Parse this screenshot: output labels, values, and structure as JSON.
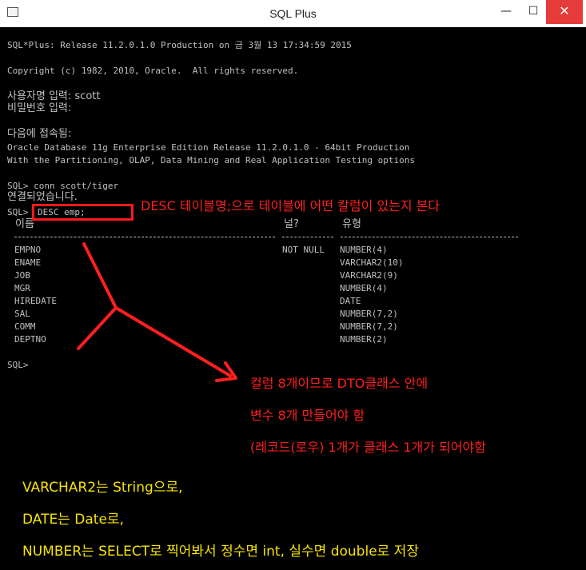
{
  "window": {
    "title": "SQL Plus",
    "minimize_glyph": "—",
    "maximize_glyph": "☐",
    "close_glyph": "✕"
  },
  "console": {
    "release_line": "SQL*Plus: Release 11.2.0.1.0 Production on 금 3월 13 17:34:59 2015",
    "copyright_line": "Copyright (c) 1982, 2010, Oracle.  All rights reserved.",
    "username_prompt": "사용자명 입력: scott",
    "password_prompt": "비밀번호 입력:",
    "connected_to": "다음에 접속됨:",
    "db_version": "Oracle Database 11g Enterprise Edition Release 11.2.0.1.0 - 64bit Production",
    "db_options": "With the Partitioning, OLAP, Data Mining and Real Application Testing options",
    "conn_command": "SQL> conn scott/tiger",
    "connected": "연결되었습니다.",
    "desc_prompt": "SQL>",
    "desc_command": "DESC emp;",
    "final_prompt": "SQL>"
  },
  "desc_table": {
    "headers": {
      "name": "이름",
      "null": "널?",
      "type": "유형"
    },
    "rows": [
      {
        "name": "EMPNO",
        "null": "NOT NULL",
        "type": "NUMBER(4)"
      },
      {
        "name": "ENAME",
        "null": "",
        "type": "VARCHAR2(10)"
      },
      {
        "name": "JOB",
        "null": "",
        "type": "VARCHAR2(9)"
      },
      {
        "name": "MGR",
        "null": "",
        "type": "NUMBER(4)"
      },
      {
        "name": "HIREDATE",
        "null": "",
        "type": "DATE"
      },
      {
        "name": "SAL",
        "null": "",
        "type": "NUMBER(7,2)"
      },
      {
        "name": "COMM",
        "null": "",
        "type": "NUMBER(7,2)"
      },
      {
        "name": "DEPTNO",
        "null": "",
        "type": "NUMBER(2)"
      }
    ]
  },
  "annotations": {
    "color_red": "#ff1f1f",
    "color_yellow": "#f7e400",
    "desc_note": "DESC 테이블명;으로 테이블에 어떤 칼럼이 있는지 본다",
    "dto_note_1": "컬럼 8개이므로 DTO클래스 안에",
    "dto_note_2": "변수 8개 만들어야 함",
    "dto_note_3": "(레코드(로우) 1개가 클래스 1개가 되어야함",
    "type_note_1": "VARCHAR2는 String으로,",
    "type_note_2": "DATE는 Date로,",
    "type_note_3": "NUMBER는 SELECT로 찍어봐서 정수면 int, 실수면 double로 저장"
  }
}
